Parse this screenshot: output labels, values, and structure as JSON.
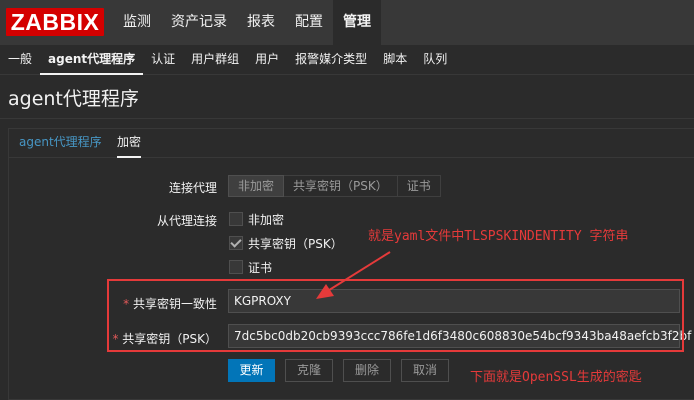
{
  "logo": "ZABBIX",
  "main_nav": [
    {
      "label": "监测"
    },
    {
      "label": "资产记录"
    },
    {
      "label": "报表"
    },
    {
      "label": "配置"
    },
    {
      "label": "管理"
    }
  ],
  "sub_nav": [
    {
      "label": "一般"
    },
    {
      "label": "agent代理程序"
    },
    {
      "label": "认证"
    },
    {
      "label": "用户群组"
    },
    {
      "label": "用户"
    },
    {
      "label": "报警媒介类型"
    },
    {
      "label": "脚本"
    },
    {
      "label": "队列"
    }
  ],
  "page_title": "agent代理程序",
  "tabs": {
    "proxy": "agent代理程序",
    "encryption": "加密"
  },
  "form": {
    "connect_to_proxy_label": "连接代理",
    "connect_options": [
      "非加密",
      "共享密钥（PSK）",
      "证书"
    ],
    "connect_selected": "非加密",
    "connect_from_proxy_label": "从代理连接",
    "from_options": [
      {
        "label": "非加密",
        "checked": false
      },
      {
        "label": "共享密钥（PSK）",
        "checked": true
      },
      {
        "label": "证书",
        "checked": false
      }
    ],
    "psk_identity_label": "共享密钥一致性",
    "psk_identity_value": "KGPROXY",
    "psk_label": "共享密钥（PSK）",
    "psk_value": "7dc5bc0db20cb9393ccc786fe1d6f3480c608830e54bcf9343ba48aefcb3f2bf",
    "required_mark": "*"
  },
  "buttons": {
    "update": "更新",
    "clone": "克隆",
    "delete": "删除",
    "cancel": "取消"
  },
  "annotations": {
    "top": "就是yaml文件中TLSPSKINDENTITY 字符串",
    "bottom": "下面就是OpenSSL生成的密匙"
  },
  "colors": {
    "annotation_red": "#e53a3a",
    "logo_red": "#d40000",
    "primary_blue": "#0275b8",
    "link_blue": "#4796c4"
  }
}
